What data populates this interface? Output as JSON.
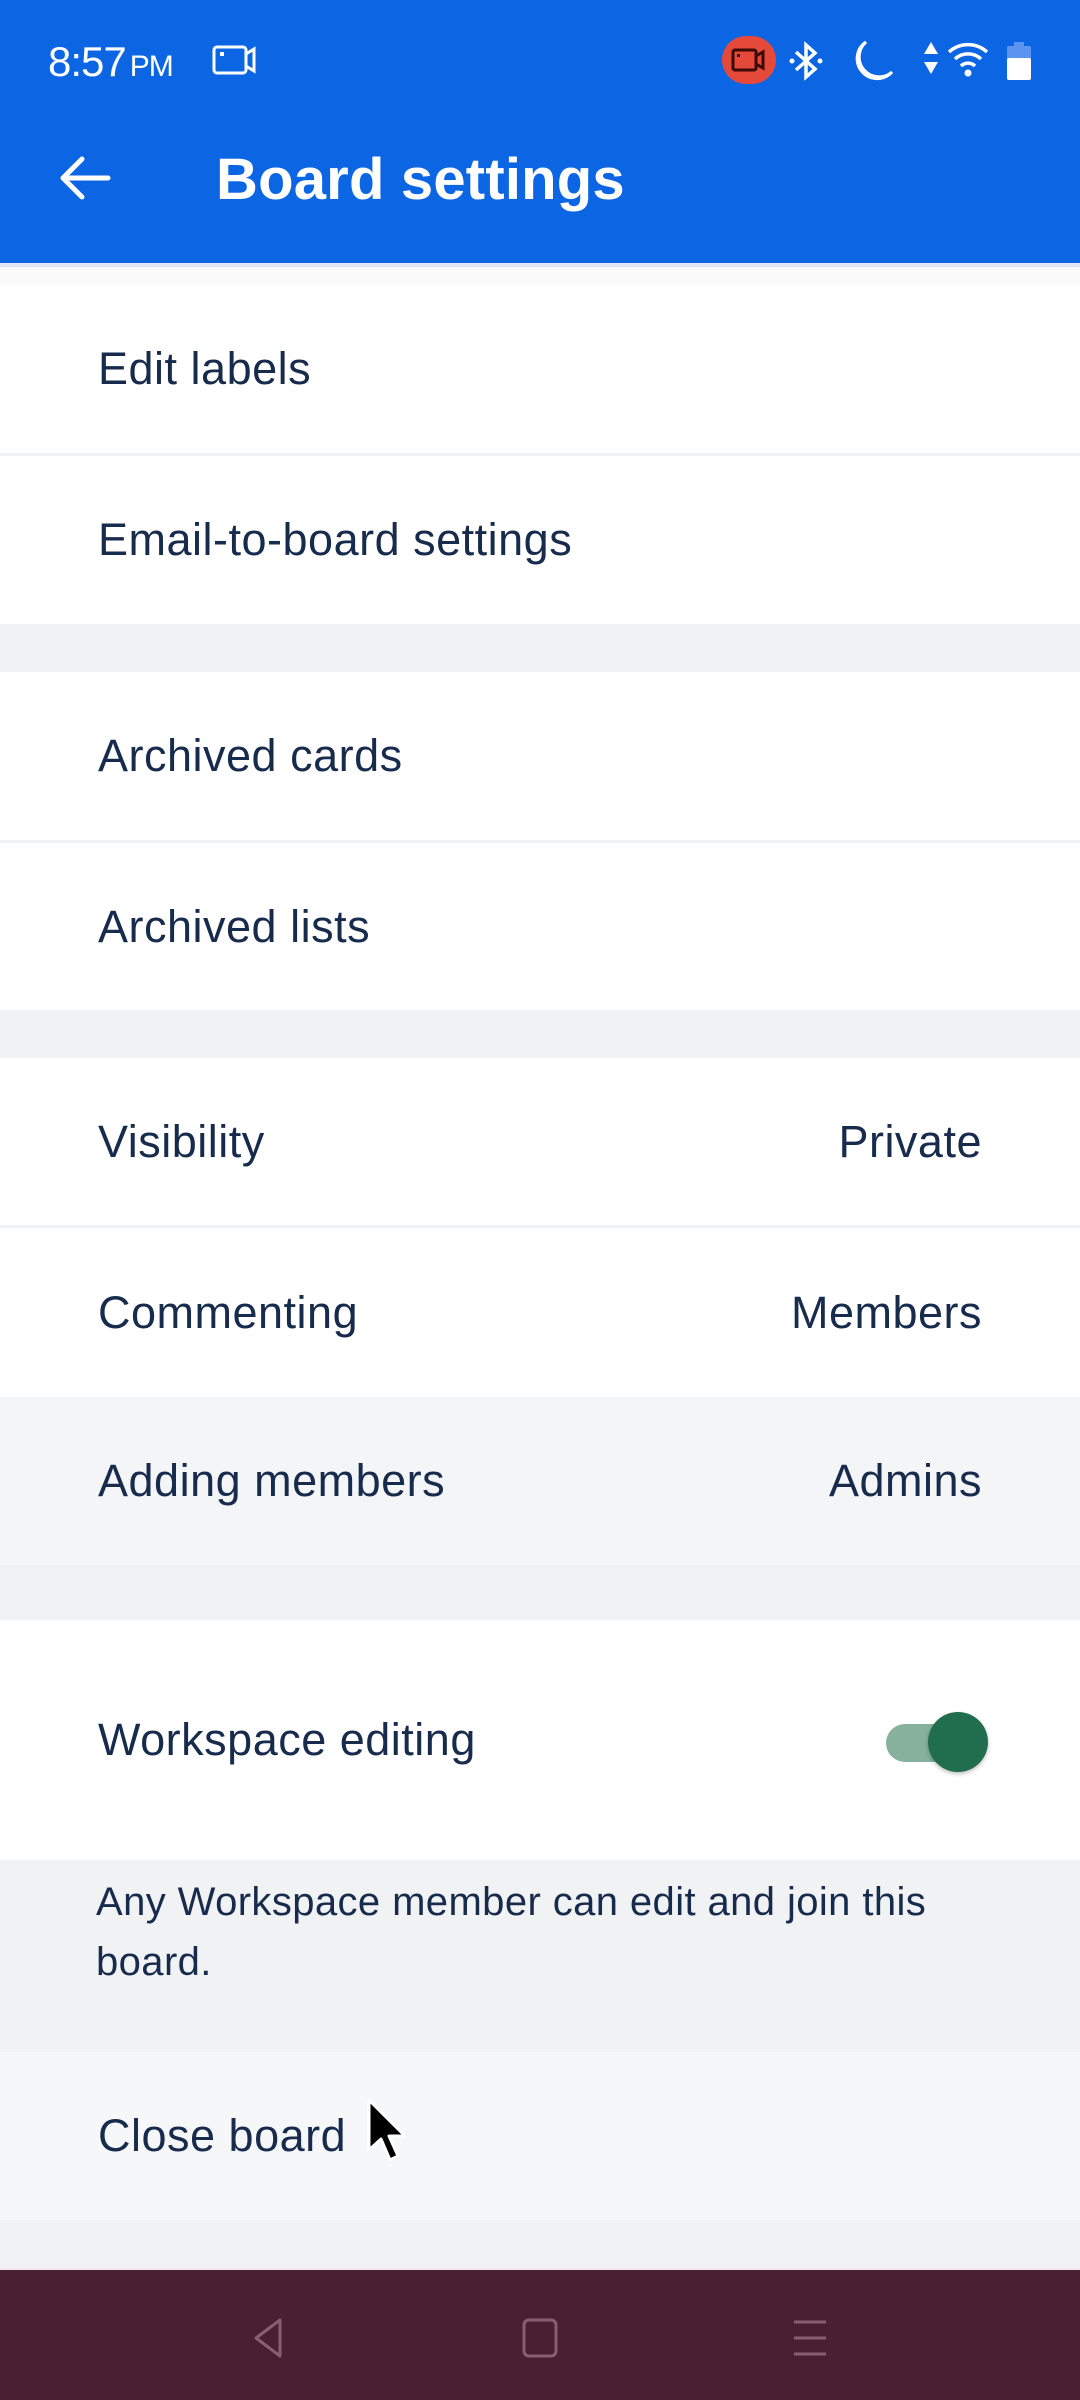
{
  "status_bar": {
    "time": "8:57",
    "ampm": "PM",
    "icons": [
      "screen-record-icon",
      "recording-indicator-icon",
      "bluetooth-icon",
      "do-not-disturb-moon-icon",
      "data-arrows-icon",
      "wifi-icon",
      "battery-icon"
    ]
  },
  "header": {
    "title": "Board settings",
    "back_icon": "arrow-left-icon",
    "color": "#0c66e4"
  },
  "settings": {
    "edit_labels": "Edit labels",
    "email_to_board": "Email-to-board settings",
    "archived_cards": "Archived cards",
    "archived_lists": "Archived lists",
    "visibility": {
      "label": "Visibility",
      "value": "Private"
    },
    "commenting": {
      "label": "Commenting",
      "value": "Members"
    },
    "adding_members": {
      "label": "Adding members",
      "value": "Admins"
    },
    "workspace_editing": {
      "label": "Workspace editing",
      "enabled": true,
      "description": "Any Workspace member can edit and join this board."
    },
    "close_board": "Close board"
  },
  "nav_bar": {
    "buttons": [
      "back-triangle-icon",
      "home-square-icon",
      "recents-menu-icon"
    ],
    "color": "#4a1f33"
  },
  "colors": {
    "toggle_on": "#216e4e",
    "text": "#172b4d"
  }
}
